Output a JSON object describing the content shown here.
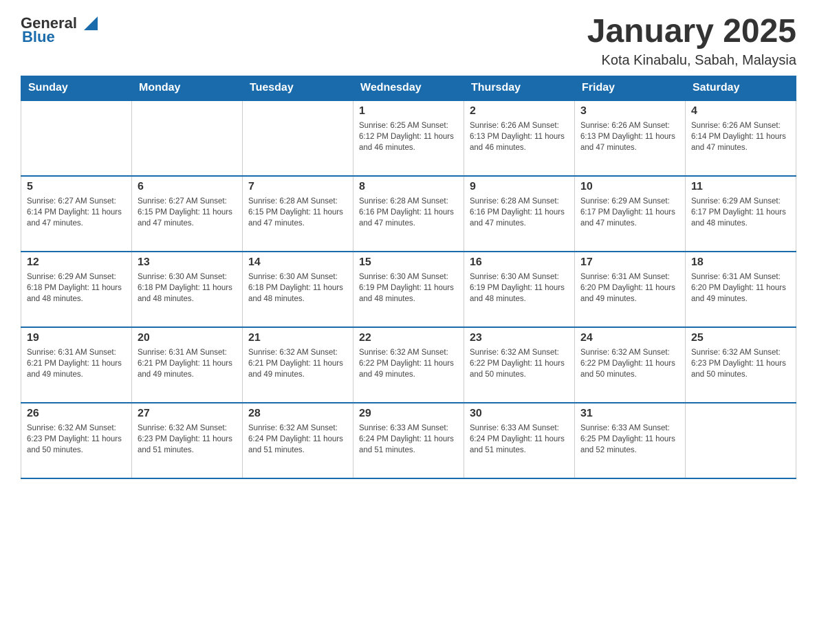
{
  "header": {
    "logo_general": "General",
    "logo_blue": "Blue",
    "title": "January 2025",
    "location": "Kota Kinabalu, Sabah, Malaysia"
  },
  "days_of_week": [
    "Sunday",
    "Monday",
    "Tuesday",
    "Wednesday",
    "Thursday",
    "Friday",
    "Saturday"
  ],
  "weeks": [
    {
      "days": [
        {
          "num": "",
          "info": ""
        },
        {
          "num": "",
          "info": ""
        },
        {
          "num": "",
          "info": ""
        },
        {
          "num": "1",
          "info": "Sunrise: 6:25 AM\nSunset: 6:12 PM\nDaylight: 11 hours and 46 minutes."
        },
        {
          "num": "2",
          "info": "Sunrise: 6:26 AM\nSunset: 6:13 PM\nDaylight: 11 hours and 46 minutes."
        },
        {
          "num": "3",
          "info": "Sunrise: 6:26 AM\nSunset: 6:13 PM\nDaylight: 11 hours and 47 minutes."
        },
        {
          "num": "4",
          "info": "Sunrise: 6:26 AM\nSunset: 6:14 PM\nDaylight: 11 hours and 47 minutes."
        }
      ]
    },
    {
      "days": [
        {
          "num": "5",
          "info": "Sunrise: 6:27 AM\nSunset: 6:14 PM\nDaylight: 11 hours and 47 minutes."
        },
        {
          "num": "6",
          "info": "Sunrise: 6:27 AM\nSunset: 6:15 PM\nDaylight: 11 hours and 47 minutes."
        },
        {
          "num": "7",
          "info": "Sunrise: 6:28 AM\nSunset: 6:15 PM\nDaylight: 11 hours and 47 minutes."
        },
        {
          "num": "8",
          "info": "Sunrise: 6:28 AM\nSunset: 6:16 PM\nDaylight: 11 hours and 47 minutes."
        },
        {
          "num": "9",
          "info": "Sunrise: 6:28 AM\nSunset: 6:16 PM\nDaylight: 11 hours and 47 minutes."
        },
        {
          "num": "10",
          "info": "Sunrise: 6:29 AM\nSunset: 6:17 PM\nDaylight: 11 hours and 47 minutes."
        },
        {
          "num": "11",
          "info": "Sunrise: 6:29 AM\nSunset: 6:17 PM\nDaylight: 11 hours and 48 minutes."
        }
      ]
    },
    {
      "days": [
        {
          "num": "12",
          "info": "Sunrise: 6:29 AM\nSunset: 6:18 PM\nDaylight: 11 hours and 48 minutes."
        },
        {
          "num": "13",
          "info": "Sunrise: 6:30 AM\nSunset: 6:18 PM\nDaylight: 11 hours and 48 minutes."
        },
        {
          "num": "14",
          "info": "Sunrise: 6:30 AM\nSunset: 6:18 PM\nDaylight: 11 hours and 48 minutes."
        },
        {
          "num": "15",
          "info": "Sunrise: 6:30 AM\nSunset: 6:19 PM\nDaylight: 11 hours and 48 minutes."
        },
        {
          "num": "16",
          "info": "Sunrise: 6:30 AM\nSunset: 6:19 PM\nDaylight: 11 hours and 48 minutes."
        },
        {
          "num": "17",
          "info": "Sunrise: 6:31 AM\nSunset: 6:20 PM\nDaylight: 11 hours and 49 minutes."
        },
        {
          "num": "18",
          "info": "Sunrise: 6:31 AM\nSunset: 6:20 PM\nDaylight: 11 hours and 49 minutes."
        }
      ]
    },
    {
      "days": [
        {
          "num": "19",
          "info": "Sunrise: 6:31 AM\nSunset: 6:21 PM\nDaylight: 11 hours and 49 minutes."
        },
        {
          "num": "20",
          "info": "Sunrise: 6:31 AM\nSunset: 6:21 PM\nDaylight: 11 hours and 49 minutes."
        },
        {
          "num": "21",
          "info": "Sunrise: 6:32 AM\nSunset: 6:21 PM\nDaylight: 11 hours and 49 minutes."
        },
        {
          "num": "22",
          "info": "Sunrise: 6:32 AM\nSunset: 6:22 PM\nDaylight: 11 hours and 49 minutes."
        },
        {
          "num": "23",
          "info": "Sunrise: 6:32 AM\nSunset: 6:22 PM\nDaylight: 11 hours and 50 minutes."
        },
        {
          "num": "24",
          "info": "Sunrise: 6:32 AM\nSunset: 6:22 PM\nDaylight: 11 hours and 50 minutes."
        },
        {
          "num": "25",
          "info": "Sunrise: 6:32 AM\nSunset: 6:23 PM\nDaylight: 11 hours and 50 minutes."
        }
      ]
    },
    {
      "days": [
        {
          "num": "26",
          "info": "Sunrise: 6:32 AM\nSunset: 6:23 PM\nDaylight: 11 hours and 50 minutes."
        },
        {
          "num": "27",
          "info": "Sunrise: 6:32 AM\nSunset: 6:23 PM\nDaylight: 11 hours and 51 minutes."
        },
        {
          "num": "28",
          "info": "Sunrise: 6:32 AM\nSunset: 6:24 PM\nDaylight: 11 hours and 51 minutes."
        },
        {
          "num": "29",
          "info": "Sunrise: 6:33 AM\nSunset: 6:24 PM\nDaylight: 11 hours and 51 minutes."
        },
        {
          "num": "30",
          "info": "Sunrise: 6:33 AM\nSunset: 6:24 PM\nDaylight: 11 hours and 51 minutes."
        },
        {
          "num": "31",
          "info": "Sunrise: 6:33 AM\nSunset: 6:25 PM\nDaylight: 11 hours and 52 minutes."
        },
        {
          "num": "",
          "info": ""
        }
      ]
    }
  ]
}
